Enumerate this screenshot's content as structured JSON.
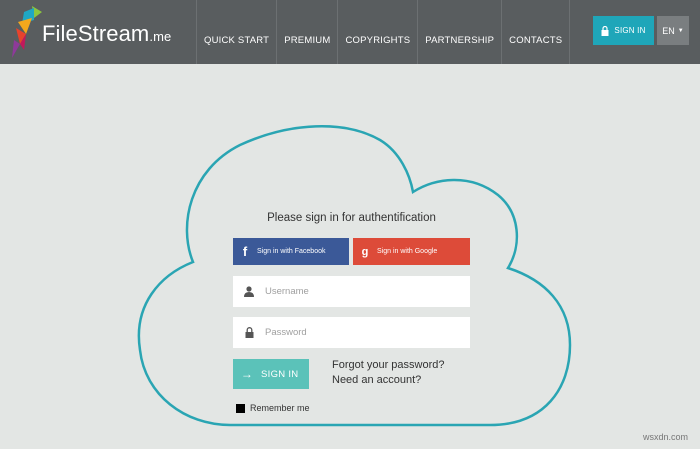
{
  "header": {
    "logo": {
      "name": "FileStream",
      "suffix": ".me"
    },
    "nav": [
      {
        "label": "QUICK START"
      },
      {
        "label": "PREMIUM"
      },
      {
        "label": "COPYRIGHTS"
      },
      {
        "label": "PARTNERSHIP"
      },
      {
        "label": "CONTACTS"
      }
    ],
    "signin_label": "SIGN IN",
    "language": "EN"
  },
  "login": {
    "heading": "Please sign in for authentification",
    "facebook_label": "Sign in with Facebook",
    "google_label": "Sign in with Google",
    "username_placeholder": "Username",
    "password_placeholder": "Password",
    "signin_label": "SIGN IN",
    "forgot_link": "Forgot your password?",
    "need_account_link": "Need an account?",
    "remember_label": "Remember me"
  },
  "watermark": "wsxdn.com",
  "icons": {
    "brand": "parrot-icon",
    "lock": "lock-icon",
    "caret": "caret-down-icon",
    "facebook": "facebook-icon",
    "google": "google-icon",
    "user": "user-icon",
    "arrow": "arrow-right-icon"
  },
  "colors": {
    "topbar": "#595d5f",
    "accent": "#1fa6b9",
    "cloud_outline": "#2aa5b3",
    "facebook": "#3b5998",
    "google": "#dd4b39",
    "signin_button": "#5bc2b9",
    "page_background": "#e3e6e4"
  }
}
